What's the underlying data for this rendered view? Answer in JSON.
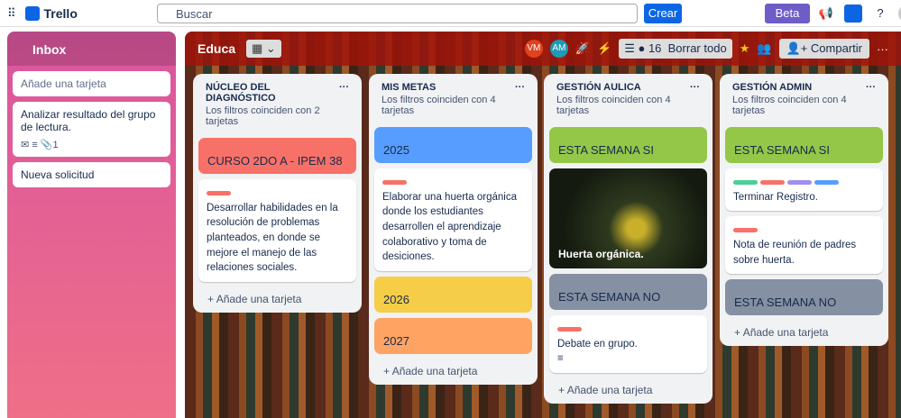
{
  "topbar": {
    "app": "Trello",
    "search_placeholder": "Buscar",
    "create": "Crear",
    "beta": "Beta"
  },
  "inbox": {
    "title": "Inbox",
    "add_placeholder": "Añade una tarjeta",
    "cards": [
      {
        "title": "Analizar resultado del grupo de lectura.",
        "attachments": "1"
      },
      {
        "title": "Nueva solicitud"
      }
    ]
  },
  "board": {
    "title": "Educa",
    "members": [
      "VM",
      "AM"
    ],
    "filter_count": "16",
    "clear": "Borrar todo",
    "share": "Compartir"
  },
  "lists": [
    {
      "title": "NÚCLEO DEL DIAGNÓSTICO",
      "filter": "Los filtros coinciden con 2 tarjetas",
      "cards": [
        {
          "cover": "CURSO 2DO A - IPEM 38"
        },
        {
          "text": "Desarrollar habilidades en la resolución de problemas planteados, en donde se mejore el manejo de las relaciones sociales."
        }
      ]
    },
    {
      "title": "MIS METAS",
      "filter": "Los filtros coinciden con 4 tarjetas",
      "cards": [
        {
          "cover": "2025"
        },
        {
          "text": "Elaborar una huerta orgánica donde los estudiantes desarrollen el aprendizaje colaborativo y toma de desiciones."
        },
        {
          "cover": "2026"
        },
        {
          "cover": "2027"
        }
      ]
    },
    {
      "title": "GESTIÓN AULICA",
      "filter": "Los filtros coinciden con 4 tarjetas",
      "cards": [
        {
          "cover": "ESTA SEMANA SI"
        },
        {
          "image_title": "Huerta orgánica."
        },
        {
          "cover": "ESTA SEMANA NO"
        },
        {
          "text": "Debate en grupo."
        }
      ]
    },
    {
      "title": "GESTIÓN ADMIN",
      "filter": "Los filtros coinciden con 4 tarjetas",
      "cards": [
        {
          "cover": "ESTA SEMANA SI"
        },
        {
          "text": "Terminar Registro."
        },
        {
          "text": "Nota de reunión de padres sobre huerta."
        },
        {
          "cover": "ESTA SEMANA NO"
        }
      ]
    }
  ],
  "add_card": "Añade una tarjeta"
}
